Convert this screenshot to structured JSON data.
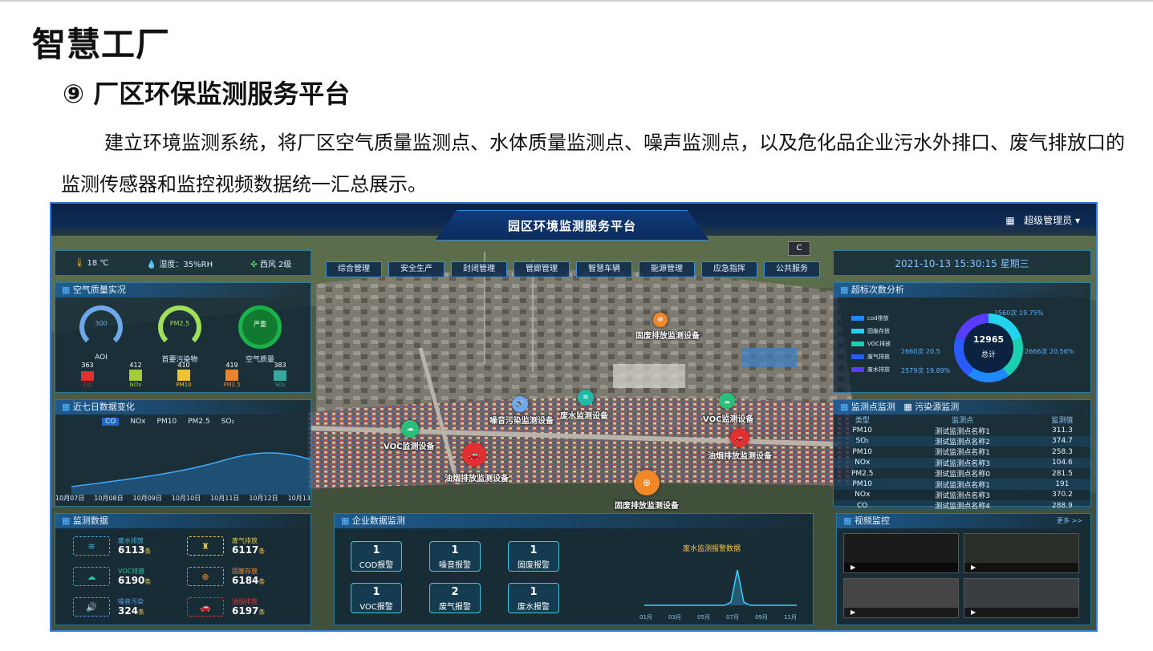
{
  "page": {
    "title": "智慧工厂",
    "subtitle": "⑨ 厂区环保监测服务平台",
    "paragraph": "建立环境监测系统，将厂区空气质量监测点、水体质量监测点、噪声监测点，以及危化品企业污水外排口、废气排放口的监测传感器和监控视频数据统一汇总展示。"
  },
  "app": {
    "title": "园区环境监测服务平台",
    "user": "超级管理员",
    "user_icon": "grid-icon",
    "datetime": "2021-10-13 15:30:15 星期三",
    "refresh_label": "C"
  },
  "weather": {
    "temp": "18 ℃",
    "humidity": "湿度：35%RH",
    "wind": "西风 2级"
  },
  "nav": [
    "综合管理",
    "安全生产",
    "封闭管理",
    "管廊管理",
    "智慧车辆",
    "能源管理",
    "应急指挥",
    "公共服务"
  ],
  "air_quality": {
    "title": "空气质量实况",
    "gauges": [
      {
        "value": "300",
        "label": "AOI",
        "color": "#6fa8e8"
      },
      {
        "value": "PM2.5",
        "label": "首要污染物",
        "color": "#9fe05a"
      },
      {
        "value": "严重",
        "label": "空气质量",
        "color": "#19b34a"
      }
    ],
    "pollutants": [
      {
        "value": "363",
        "name": "CO",
        "color": "#e0302f",
        "level": 0.86
      },
      {
        "value": "412",
        "name": "NOx",
        "color": "#a7c93a",
        "level": 0.98
      },
      {
        "value": "410",
        "name": "PM10",
        "color": "#f1c232",
        "level": 0.97
      },
      {
        "value": "419",
        "name": "PM2.5",
        "color": "#e9832c",
        "level": 1.0
      },
      {
        "value": "383",
        "name": "SO₂",
        "color": "#37a89c",
        "level": 0.91
      }
    ]
  },
  "trend": {
    "title": "近七日数据变化",
    "tabs": [
      "CO",
      "NOx",
      "PM10",
      "PM2.5",
      "SO₂"
    ],
    "dates": [
      "10月07日",
      "10月08日",
      "10月09日",
      "10月10日",
      "10月11日",
      "10月12日",
      "10月13"
    ]
  },
  "exceed": {
    "title": "超标次数分析",
    "legend": [
      {
        "name": "cod排放",
        "color": "#1e88ff"
      },
      {
        "name": "固废存放",
        "color": "#22d4ee"
      },
      {
        "name": "VOC排放",
        "color": "#19d0b0"
      },
      {
        "name": "废气排放",
        "color": "#2a5bff"
      },
      {
        "name": "废水排放",
        "color": "#5a3cff"
      }
    ],
    "total": "12965",
    "total_label": "总计",
    "labels": [
      "2560次 19.75%",
      "2666次 20.56%",
      "2579次 19.89%",
      "2660次 20.5"
    ]
  },
  "monitor_points": {
    "tab1": "监测点监测",
    "tab2": "污染源监测",
    "headers": [
      "类型",
      "监测点",
      "监测值"
    ],
    "rows": [
      [
        "PM10",
        "测试监测点名称1",
        "311.3"
      ],
      [
        "SO₂",
        "测试监测点名称2",
        "374.7"
      ],
      [
        "PM10",
        "测试监测点名称1",
        "258.3"
      ],
      [
        "NOx",
        "测试监测点名称3",
        "104.6"
      ],
      [
        "PM2.5",
        "测试监测点名称0",
        "281.5"
      ],
      [
        "PM10",
        "测试监测点名称1",
        "191"
      ],
      [
        "NOx",
        "测试监测点名称3",
        "370.2"
      ],
      [
        "CO",
        "测试监测点名称4",
        "288.9"
      ]
    ]
  },
  "monitor_data": {
    "title": "监测数据",
    "unit": "条",
    "items": [
      {
        "label": "废水排放",
        "value": "6113",
        "icon": "water-icon",
        "color": "#3fb6d8"
      },
      {
        "label": "废气排放",
        "value": "6117",
        "icon": "factory-icon",
        "color": "#e6c84a"
      },
      {
        "label": "VOC排放",
        "value": "6190",
        "icon": "cloud-icon",
        "color": "#28c79a"
      },
      {
        "label": "固废存放",
        "value": "6184",
        "icon": "bin-icon",
        "color": "#e8903a"
      },
      {
        "label": "噪音污染",
        "value": "324",
        "icon": "speaker-icon",
        "color": "#5aa0f0"
      },
      {
        "label": "油烟排放",
        "value": "6197",
        "icon": "car-icon",
        "color": "#d83a3a"
      }
    ]
  },
  "enterprise": {
    "title": "企业数据监测",
    "alarms": [
      {
        "count": "1",
        "label": "COD报警"
      },
      {
        "count": "1",
        "label": "噪音报警"
      },
      {
        "count": "1",
        "label": "固废报警"
      },
      {
        "count": "1",
        "label": "VOC报警"
      },
      {
        "count": "2",
        "label": "废气报警"
      },
      {
        "count": "1",
        "label": "废水报警"
      }
    ],
    "chart_title": "废水监测报警数据",
    "months": [
      "01月",
      "03月",
      "05月",
      "07月",
      "09月",
      "11月"
    ]
  },
  "video": {
    "title": "视频监控",
    "more": "更多 >>"
  },
  "map_markers": [
    {
      "label": "固废排放监测设备"
    },
    {
      "label": "噪音污染监测设备"
    },
    {
      "label": "废水监测设备"
    },
    {
      "label": "VOC监测设备"
    },
    {
      "label": "VOC监测设备"
    },
    {
      "label": "油烟排放监测设备"
    },
    {
      "label": "油烟排放监测设备"
    },
    {
      "label": "固废排放监测设备"
    }
  ]
}
